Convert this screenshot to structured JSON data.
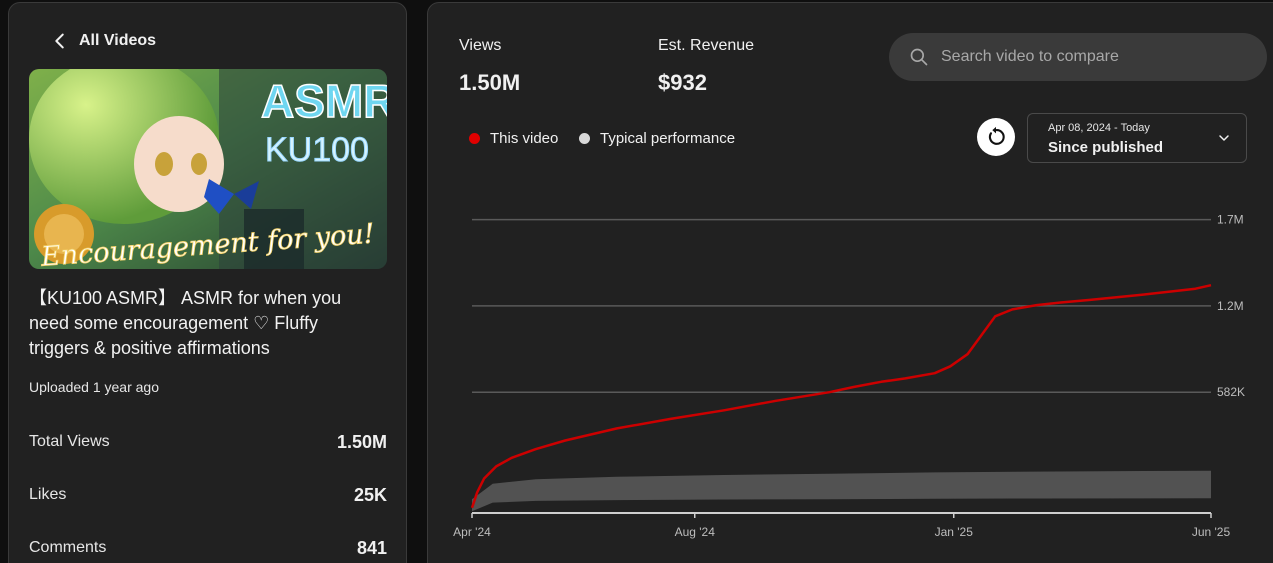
{
  "left": {
    "back_label": "All Videos",
    "thumbnail": {
      "title_text": "ASMR",
      "subtitle_text": "KU100",
      "script_text": "Encouragement for you!"
    },
    "video_title": "【KU100 ASMR】 ASMR for when you need some encouragement ♡ Fluffy triggers & positive affirmations",
    "uploaded": "Uploaded 1 year ago",
    "stats": [
      {
        "label": "Total Views",
        "value": "1.50M"
      },
      {
        "label": "Likes",
        "value": "25K"
      },
      {
        "label": "Comments",
        "value": "841"
      }
    ]
  },
  "right": {
    "metrics": [
      {
        "label": "Views",
        "value": "1.50M"
      },
      {
        "label": "Est. Revenue",
        "value": "$932"
      }
    ],
    "search": {
      "placeholder": "Search video to compare",
      "value": ""
    },
    "legend": [
      {
        "label": "This video",
        "color": "#cc0000"
      },
      {
        "label": "Typical performance",
        "color": "#d9d9d9"
      }
    ],
    "range": {
      "dates": "Apr 08, 2024 - Today",
      "label": "Since published"
    }
  },
  "chart_data": {
    "type": "area",
    "x_ticks": [
      "Apr '24",
      "Aug '24",
      "Jan '25",
      "Jun '25"
    ],
    "y_ticks": [
      "1.7M",
      "1.2M",
      "582K"
    ],
    "ylim": [
      0,
      1750000
    ],
    "grid": true,
    "series": [
      {
        "name": "This video",
        "color": "#cc0000",
        "x": [
          "2024-04-08",
          "2024-04-11",
          "2024-04-15",
          "2024-04-22",
          "2024-05-01",
          "2024-05-15",
          "2024-06-01",
          "2024-07-01",
          "2024-08-01",
          "2024-09-01",
          "2024-10-01",
          "2024-11-01",
          "2024-11-15",
          "2024-12-01",
          "2024-12-15",
          "2025-01-01",
          "2025-01-10",
          "2025-01-20",
          "2025-01-28",
          "2025-02-05",
          "2025-02-15",
          "2025-03-01",
          "2025-03-15",
          "2025-04-01",
          "2025-05-01",
          "2025-06-01",
          "2025-06-10"
        ],
        "y": [
          30000,
          120000,
          200000,
          270000,
          320000,
          370000,
          420000,
          490000,
          545000,
          595000,
          650000,
          700000,
          730000,
          760000,
          780000,
          810000,
          850000,
          920000,
          1030000,
          1140000,
          1180000,
          1205000,
          1220000,
          1235000,
          1265000,
          1300000,
          1320000
        ]
      },
      {
        "name": "Typical performance",
        "color": "#555555",
        "band_x": [
          "2024-04-08",
          "2024-04-20",
          "2024-05-15",
          "2024-07-01",
          "2024-09-01",
          "2024-11-01",
          "2025-01-01",
          "2025-03-01",
          "2025-06-10"
        ],
        "band_low": [
          10000,
          60000,
          70000,
          75000,
          78000,
          80000,
          82000,
          84000,
          86000
        ],
        "band_high": [
          80000,
          170000,
          195000,
          210000,
          220000,
          228000,
          235000,
          240000,
          245000
        ]
      }
    ]
  }
}
